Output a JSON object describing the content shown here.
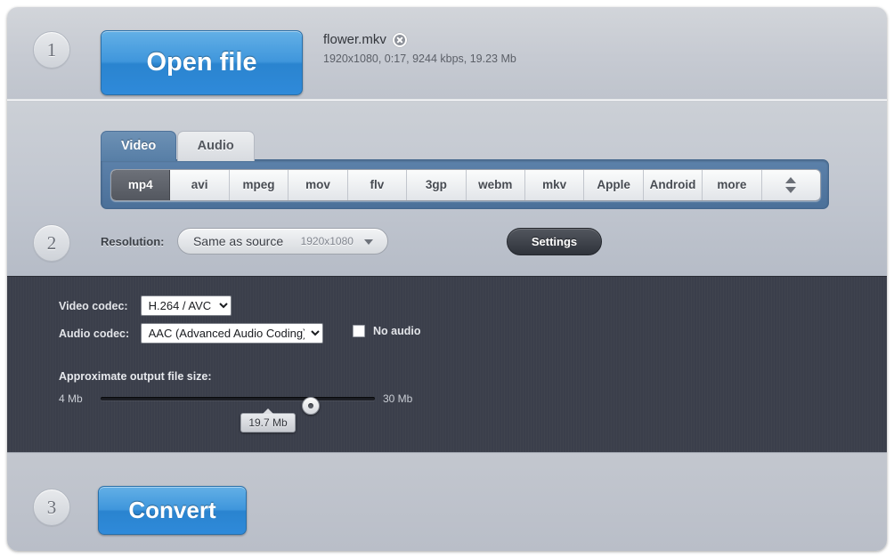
{
  "steps": {
    "one": "1",
    "two": "2",
    "three": "3"
  },
  "open_section": {
    "open_button_label": "Open file",
    "file_name": "flower.mkv",
    "file_meta": "1920x1080, 0:17, 9244 kbps, 19.23 Mb",
    "remove_icon": "close-circle-icon"
  },
  "format_section": {
    "tabs": [
      {
        "label": "Video",
        "active": true
      },
      {
        "label": "Audio",
        "active": false
      }
    ],
    "formats": [
      {
        "label": "mp4",
        "selected": true
      },
      {
        "label": "avi",
        "selected": false
      },
      {
        "label": "mpeg",
        "selected": false
      },
      {
        "label": "mov",
        "selected": false
      },
      {
        "label": "flv",
        "selected": false
      },
      {
        "label": "3gp",
        "selected": false
      },
      {
        "label": "webm",
        "selected": false
      },
      {
        "label": "mkv",
        "selected": false
      },
      {
        "label": "Apple",
        "selected": false
      },
      {
        "label": "Android",
        "selected": false
      },
      {
        "label": "more",
        "selected": false
      }
    ],
    "stepper_icon": "up-down-stepper-icon",
    "resolution_label": "Resolution:",
    "resolution_value": "Same as source",
    "resolution_detail": "1920x1080",
    "resolution_caret_icon": "chevron-down-icon",
    "settings_button_label": "Settings"
  },
  "settings_section": {
    "video_codec_label": "Video codec:",
    "video_codec_value": "H.264 / AVC",
    "video_codec_options": [
      "H.264 / AVC"
    ],
    "audio_codec_label": "Audio codec:",
    "audio_codec_value": "AAC (Advanced Audio Coding)",
    "audio_codec_options": [
      "AAC (Advanced Audio Coding)"
    ],
    "no_audio_label": "No audio",
    "no_audio_checked": false,
    "file_size_title": "Approximate output file size:",
    "slider_min_label": "4 Mb",
    "slider_max_label": "30 Mb",
    "slider_value_label": "19.7 Mb"
  },
  "convert_section": {
    "convert_button_label": "Convert"
  },
  "colors": {
    "accent_blue": "#3f96dc",
    "tab_active_blue": "#577ea6",
    "dark_panel": "#3b3f4b",
    "panel_gray": "#c6cad2"
  }
}
